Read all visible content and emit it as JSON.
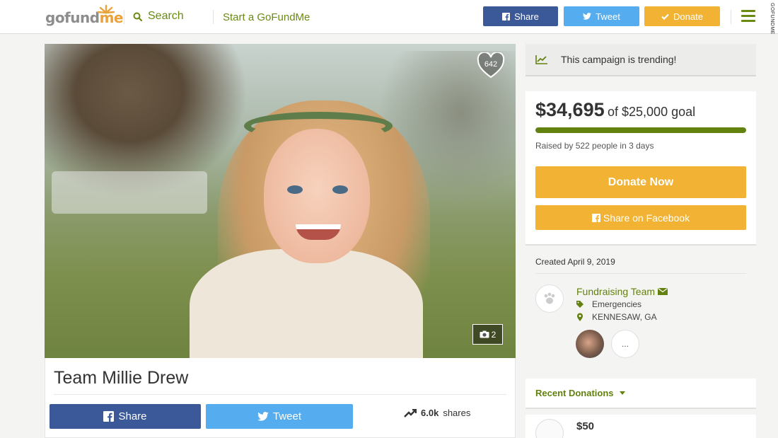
{
  "header": {
    "logo_go": "gofund",
    "logo_me": "me",
    "search_label": "Search",
    "start_label": "Start a GoFundMe",
    "share_label": "Share",
    "tweet_label": "Tweet",
    "donate_label": "Donate",
    "side_credit": "GOFUNDME"
  },
  "photo": {
    "hearts": "642",
    "photo_count": "2"
  },
  "campaign": {
    "title": "Team Millie Drew",
    "share_label": "Share",
    "tweet_label": "Tweet",
    "shares_count": "6.0k",
    "shares_suffix": "shares"
  },
  "sidebar": {
    "trending_text": "This campaign is trending!",
    "amount_raised": "$34,695",
    "goal_text": "of $25,000 goal",
    "progress_fraction": 1.0,
    "raised_by": "Raised by 522 people in 3 days",
    "donate_now_label": "Donate Now",
    "share_facebook_label": "Share on Facebook",
    "created": "Created April 9, 2019",
    "organizer_name": "Fundraising Team",
    "category": "Emergencies",
    "location": "KENNESAW, GA",
    "more_members": "...",
    "recent_donations_label": "Recent Donations",
    "first_donation_amount": "$50"
  },
  "colors": {
    "brand_green": "#62810f",
    "donate_orange": "#f2b233",
    "facebook_blue": "#3b5998",
    "twitter_blue": "#55acee"
  }
}
